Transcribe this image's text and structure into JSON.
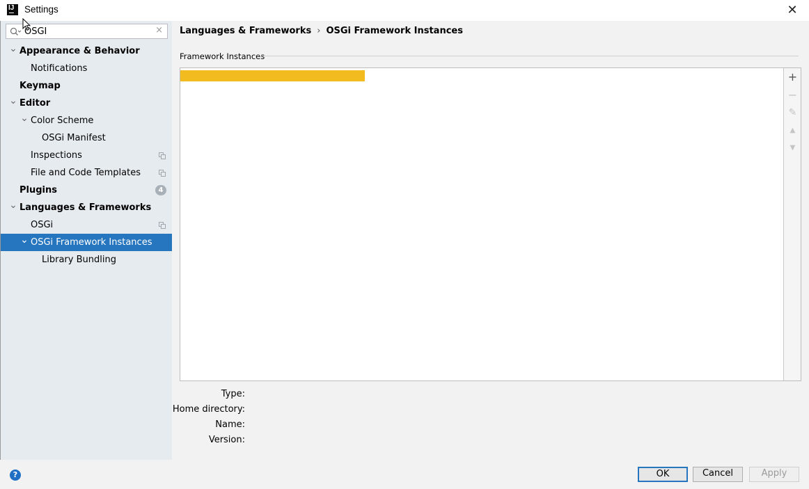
{
  "window": {
    "title": "Settings",
    "close_glyph": "✕"
  },
  "search": {
    "value": "OSGI",
    "clear_glyph": "×"
  },
  "tree": [
    {
      "label": "Appearance & Behavior",
      "level": 0,
      "bold": true,
      "expanded": true
    },
    {
      "label": "Notifications",
      "level": 1,
      "bold": false
    },
    {
      "label": "Keymap",
      "level": 0,
      "bold": true
    },
    {
      "label": "Editor",
      "level": 0,
      "bold": true,
      "expanded": true
    },
    {
      "label": "Color Scheme",
      "level": 1,
      "bold": false,
      "expanded": true
    },
    {
      "label": "OSGi Manifest",
      "level": 2,
      "bold": false
    },
    {
      "label": "Inspections",
      "level": 1,
      "bold": false,
      "copy": true
    },
    {
      "label": "File and Code Templates",
      "level": 1,
      "bold": false,
      "copy": true
    },
    {
      "label": "Plugins",
      "level": 0,
      "bold": true,
      "badge": "4"
    },
    {
      "label": "Languages & Frameworks",
      "level": 0,
      "bold": true,
      "expanded": true
    },
    {
      "label": "OSGi",
      "level": 1,
      "bold": false,
      "copy": true
    },
    {
      "label": "OSGi Framework Instances",
      "level": 1,
      "bold": false,
      "expanded": true,
      "selected": true
    },
    {
      "label": "Library Bundling",
      "level": 2,
      "bold": false
    }
  ],
  "breadcrumb": {
    "parent": "Languages & Frameworks",
    "separator": "›",
    "current": "OSGi Framework Instances"
  },
  "section": {
    "title": "Framework Instances"
  },
  "toolbar": {
    "add": "+",
    "remove": "−",
    "edit": "✎",
    "up": "▲",
    "down": "▼"
  },
  "properties": [
    {
      "label": "Type:",
      "value": ""
    },
    {
      "label": "Home directory:",
      "value": ""
    },
    {
      "label": "Name:",
      "value": ""
    },
    {
      "label": "Version:",
      "value": ""
    }
  ],
  "buttons": {
    "help": "?",
    "ok": "OK",
    "cancel": "Cancel",
    "apply": "Apply"
  },
  "colors": {
    "selection": "#2675bf",
    "list_highlight": "#f2bb20",
    "sidebar_bg": "#e6ebf0"
  },
  "icons": {
    "app": "intellij-icon",
    "search": "search-icon",
    "copy": "copy-icon",
    "help": "help-icon"
  }
}
